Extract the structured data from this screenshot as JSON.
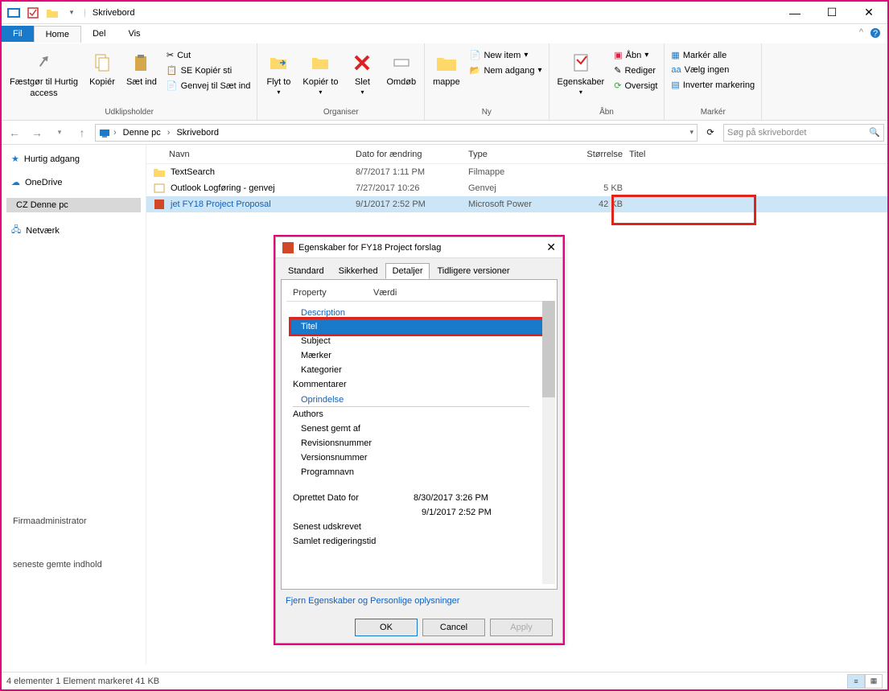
{
  "window": {
    "title": "Skrivebord"
  },
  "tabs": {
    "file": "Fil",
    "home": "Home",
    "share": "Del",
    "view": "Vis"
  },
  "ribbon": {
    "clipboard": {
      "label": "Udklipsholder",
      "pin": "Fæstgør til Hurtig",
      "access": "access",
      "copy": "Kopiér",
      "paste": "Sæt ind",
      "cut": "Cut",
      "copy_path": "SE Kopiér sti",
      "paste_shortcut": "Genvej til Sæt ind"
    },
    "organize": {
      "label": "Organiser",
      "move_to": "Flyt to",
      "copy_to": "Kopiér to",
      "delete": "Slet",
      "rename": "Omdøb"
    },
    "new": {
      "label": "Ny",
      "folder": "mappe",
      "new_item": "New item",
      "easy_access": "Nem adgang"
    },
    "open": {
      "label": "Åbn",
      "properties": "Egenskaber",
      "open": "Åbn",
      "edit": "Rediger",
      "history": "Oversigt"
    },
    "select": {
      "label": "Markér",
      "select_all": "Markér alle",
      "select_none": "Vælg ingen",
      "invert": "Inverter markering"
    }
  },
  "breadcrumb": {
    "this_pc": "Denne pc",
    "desktop": "Skrivebord"
  },
  "search": {
    "placeholder": "Søg på skrivebordet"
  },
  "columns": {
    "name": "Navn",
    "date": "Dato for ændring",
    "type": "Type",
    "size": "Størrelse",
    "title": "Titel"
  },
  "sidebar": {
    "quick": "Hurtig adgang",
    "onedrive": "OneDrive",
    "this_pc": "CZ Denne pc",
    "network": "Netværk"
  },
  "files": [
    {
      "name": "TextSearch",
      "date": "8/7/2017 1:11 PM",
      "type": "Filmappe",
      "size": ""
    },
    {
      "name": "Outlook Logføring - genvej",
      "date": "7/27/2017 10:26",
      "type": "Genvej",
      "size": "5 KB"
    },
    {
      "name": "jet FY18 Project Proposal",
      "date": "9/1/2017 2:52 PM",
      "type": "Microsoft Power",
      "size": "42 KB"
    }
  ],
  "extra": {
    "firm": "Firmaadministrator",
    "last_saved": "seneste gemte indhold"
  },
  "dialog": {
    "title": "Egenskaber for FY18 Project forslag",
    "tabs": {
      "general": "Standard",
      "security": "Sikkerhed",
      "details": "Detaljer",
      "previous": "Tidligere versioner"
    },
    "header": {
      "property": "Property",
      "value": "Værdi"
    },
    "sections": {
      "description": "Description",
      "origin": "Oprindelse"
    },
    "props": {
      "title": "Titel",
      "subject": "Subject",
      "tags": "Mærker",
      "categories": "Kategorier",
      "comments": "Kommentarer",
      "authors": "Authors",
      "last_saved_by": "Senest gemt af",
      "revision": "Revisionsnummer",
      "version": "Versionsnummer",
      "program": "Programnavn",
      "created": "Oprettet Dato for",
      "created_v1": "8/30/2017 3:26 PM",
      "created_v2": "9/1/2017 2:52 PM",
      "printed": "Senest udskrevet",
      "edit_time": "Samlet redigeringstid"
    },
    "link": "Fjern Egenskaber og Personlige oplysninger",
    "buttons": {
      "ok": "OK",
      "cancel": "Cancel",
      "apply": "Apply"
    }
  },
  "status": {
    "text": "4 elementer 1 Element markeret 41 KB"
  }
}
